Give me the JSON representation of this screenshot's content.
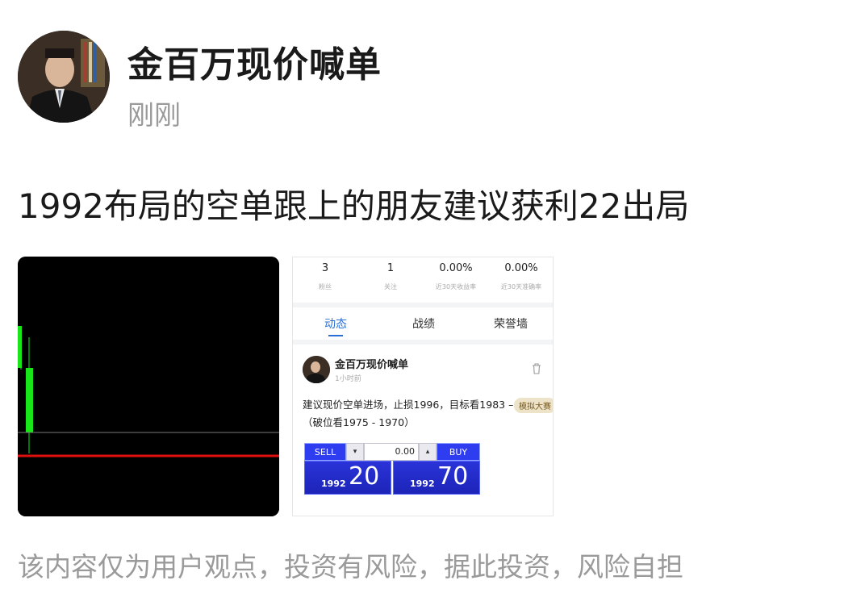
{
  "post": {
    "author": "金百万现价喊单",
    "time": "刚刚",
    "text": "1992布局的空单跟上的朋友建议获利22出局",
    "disclaimer": "该内容仅为用户观点，投资有风险，据此投资，风险自担"
  },
  "screenshot": {
    "stats": [
      {
        "value": "3",
        "label": "粉丝"
      },
      {
        "value": "1",
        "label": "关注"
      },
      {
        "value": "0.00%",
        "label": "近30天收益率"
      },
      {
        "value": "0.00%",
        "label": "近30天准确率"
      }
    ],
    "tabs": [
      "动态",
      "战绩",
      "荣誉墙"
    ],
    "mini_post": {
      "author": "金百万现价喊单",
      "time": "1小时前",
      "text": "建议现价空单进场，止损1996，目标看1983 – 1980（破位看1975 - 1970）",
      "badge": "模拟大赛"
    },
    "trade": {
      "sell": "SELL",
      "buy": "BUY",
      "qty": "0.00",
      "sell_small": "1992",
      "sell_big": "20",
      "buy_small": "1992",
      "buy_big": "70"
    }
  },
  "colors": {
    "accent": "#2a6fd6",
    "candle_green": "#19e619",
    "line_red": "#e01010"
  }
}
